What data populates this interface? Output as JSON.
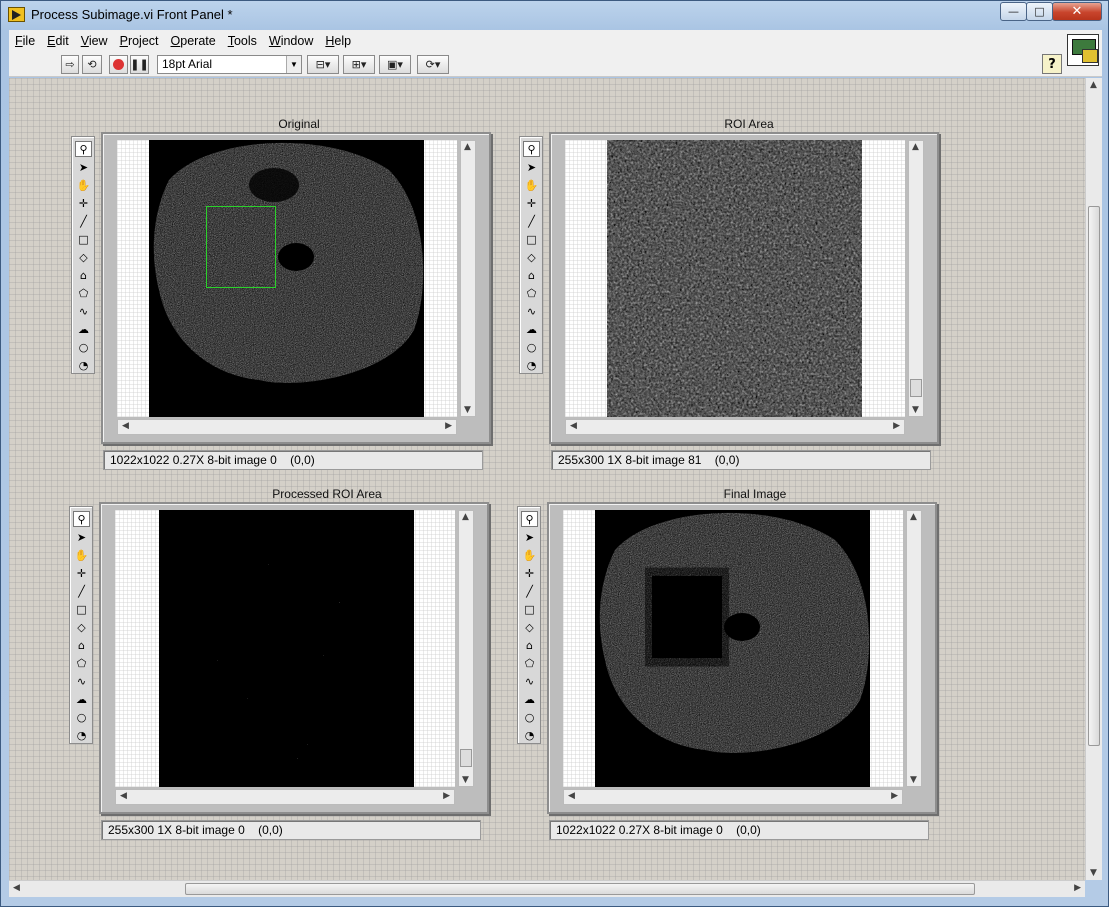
{
  "window": {
    "title": "Process Subimage.vi Front Panel *",
    "minimize_glyph": "—",
    "maximize_glyph": "□",
    "close_glyph": "✕"
  },
  "menu": [
    {
      "u": "F",
      "rest": "ile"
    },
    {
      "u": "E",
      "rest": "dit"
    },
    {
      "u": "V",
      "rest": "iew"
    },
    {
      "u": "P",
      "rest": "roject"
    },
    {
      "u": "O",
      "rest": "perate"
    },
    {
      "u": "T",
      "rest": "ools"
    },
    {
      "u": "W",
      "rest": "indow"
    },
    {
      "u": "H",
      "rest": "elp"
    }
  ],
  "toolbar": {
    "font": "18pt Arial",
    "help": "?",
    "icons": [
      "run-arrow-icon",
      "run-continuously-icon",
      "abort-icon",
      "pause-icon",
      "align-objects-icon",
      "distribute-objects-icon",
      "resize-objects-icon",
      "reorder-icon"
    ]
  },
  "displays": {
    "original": {
      "label": "Original",
      "status": "1022x1022 0.27X 8-bit image 0    (0,0)"
    },
    "roi": {
      "label": "ROI Area",
      "status": "255x300 1X 8-bit image 81    (0,0)"
    },
    "processed": {
      "label": "Processed ROI Area",
      "status": "255x300 1X 8-bit image 0    (0,0)"
    },
    "final": {
      "label": "Final Image",
      "status": "1022x1022 0.27X 8-bit image 0    (0,0)"
    }
  },
  "tools": [
    "zoom-icon",
    "pointer-icon",
    "pan-icon",
    "point-icon",
    "line-icon",
    "rectangle-icon",
    "rotated-rectangle-icon",
    "polyline-icon",
    "polygon-icon",
    "freehand-line-icon",
    "freehand-region-icon",
    "oval-icon",
    "annulus-icon"
  ],
  "tool_glyphs": [
    "⚲",
    "➤",
    "✋",
    "✛",
    "╱",
    "□",
    "◇",
    "⌂",
    "⬠",
    "∿",
    "☁",
    "○",
    "◔"
  ]
}
